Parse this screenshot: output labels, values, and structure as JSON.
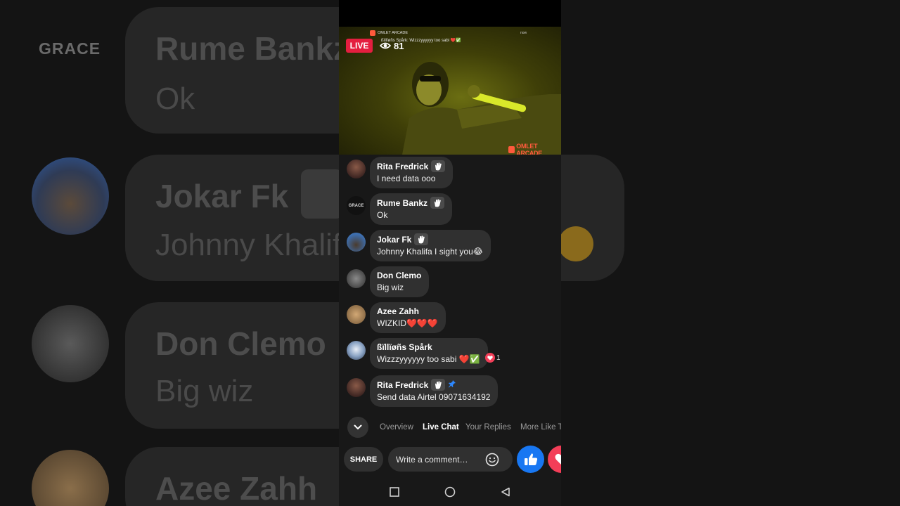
{
  "stream": {
    "live_label": "LIVE",
    "viewer_count": "81",
    "overlay_app": "OMLET ARCADE",
    "overlay_comment": "ßïllïøñs Spårk: Wizzzyyyyyy too sabi ❤️✅",
    "overlay_right": "now",
    "watermark": "OMLET ARCADE"
  },
  "background": {
    "logo_text": "GRACE",
    "rows": [
      {
        "name": "Rume Bankz",
        "text": "Ok"
      },
      {
        "name": "Jokar Fk",
        "text": "Johnny Khalifa I sight you"
      },
      {
        "name": "Don Clemo",
        "text": "Big wiz"
      },
      {
        "name": "Azee Zahh",
        "text": ""
      }
    ]
  },
  "chat": {
    "messages": [
      {
        "name": "Rita Fredrick",
        "text": "I need data ooo",
        "avatar_color": "#5a3a33"
      },
      {
        "name": "Rume Bankz",
        "text": "Ok",
        "avatar_text": "GRACE",
        "avatar_color": "#111111"
      },
      {
        "name": "Jokar Fk",
        "text": "Johnny Khalifa I sight you😂",
        "avatar_color": "#3d6fb0"
      },
      {
        "name": "Don Clemo",
        "text": "Big wiz",
        "avatar_color": "#6d6d6d"
      },
      {
        "name": "Azee Zahh",
        "text": "WIZKID❤️❤️❤️",
        "avatar_color": "#b88d62"
      },
      {
        "name": "ßïllïøñs Spårk",
        "text": "Wizzzyyyyyy too sabi ❤️✅",
        "avatar_color": "#8aa3c4",
        "reaction_count": "1"
      },
      {
        "name": "Rita Fredrick",
        "text": "Send data Airtel 09071634192",
        "avatar_color": "#5a3a33"
      }
    ]
  },
  "tabs": [
    {
      "label": "Overview",
      "active": false
    },
    {
      "label": "Live Chat",
      "active": true
    },
    {
      "label": "Your Replies",
      "active": false
    },
    {
      "label": "More Like T",
      "active": false
    }
  ],
  "composer": {
    "share_label": "SHARE",
    "placeholder": "Write a comment…"
  },
  "colors": {
    "live_red": "#e41e3f",
    "like_blue": "#1877f2",
    "love_red": "#f33e58",
    "bubble": "#303030"
  },
  "icons": [
    "eye-icon",
    "wave-badge-icon",
    "pin-icon",
    "heart-reaction-icon",
    "chevron-down-icon",
    "emoji-icon",
    "thumbs-up-icon",
    "heart-icon",
    "square-icon",
    "circle-icon",
    "triangle-back-icon"
  ]
}
